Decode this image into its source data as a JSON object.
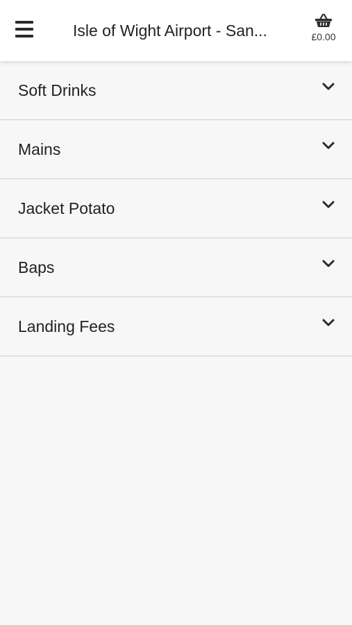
{
  "header": {
    "title": "Isle of Wight Airport - San...",
    "basket_total": "£0.00"
  },
  "categories": [
    {
      "label": "Soft Drinks"
    },
    {
      "label": "Mains"
    },
    {
      "label": "Jacket Potato"
    },
    {
      "label": "Baps"
    },
    {
      "label": "Landing Fees"
    }
  ],
  "icons": {
    "menu": "hamburger-menu-icon",
    "basket": "basket-icon",
    "expand": "chevron-down-icon"
  }
}
